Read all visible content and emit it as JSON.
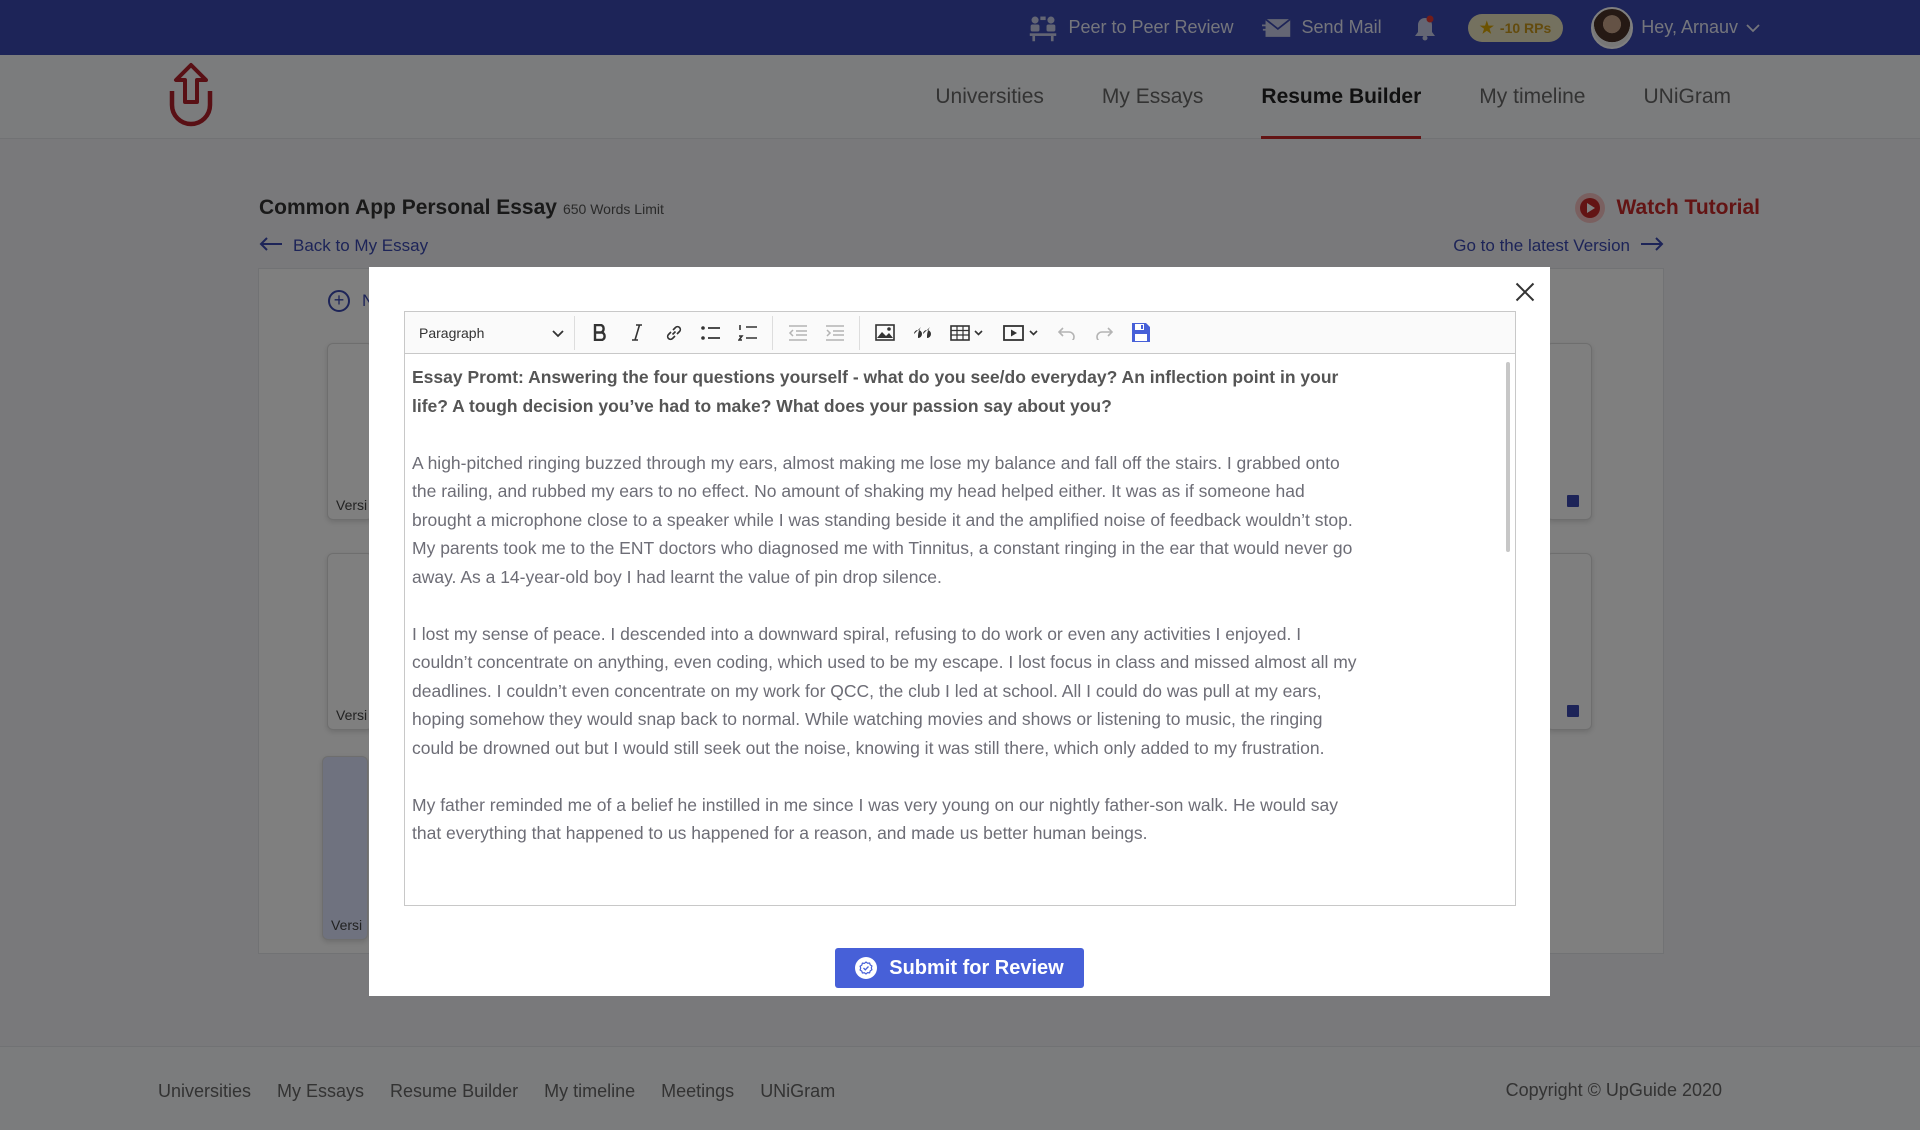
{
  "topbar": {
    "peer_review": "Peer to Peer Review",
    "send_mail": "Send Mail",
    "rp_badge": "-10 RPs",
    "greeting": "Hey, Arnauv"
  },
  "nav": {
    "items": [
      "Universities",
      "My Essays",
      "Resume Builder",
      "My timeline",
      "UNiGram"
    ],
    "active": "Resume Builder",
    "accent_color": "#c62828"
  },
  "page": {
    "title": "Common App Personal Essay",
    "word_limit": "650 Words Limit",
    "back_link": "Back to My Essay",
    "latest_link": "Go to the latest Version",
    "watch_tutorial": "Watch Tutorial",
    "add_version_label": "N",
    "version_label": "Versi"
  },
  "editor": {
    "block_format": "Paragraph",
    "toolbar_icons": [
      "bold-icon",
      "italic-icon",
      "link-icon",
      "bulleted-list-icon",
      "numbered-list-icon",
      "outdent-icon",
      "indent-icon",
      "image-icon",
      "blockquote-icon",
      "table-icon",
      "media-icon",
      "undo-icon",
      "redo-icon",
      "save-icon"
    ],
    "paragraphs": [
      "Essay Promt: Answering the four questions yourself - what do you see/do everyday? An inflection point in your life? A tough  decision you’ve had to make? What does your passion say about you?",
      "A  high-pitched ringing buzzed through my ears, almost making me lose my balance and fall off the stairs. I grabbed onto the railing, and rubbed my ears to no effect. No amount of shaking my head helped either. It was as if someone had brought a microphone close to a speaker while I was standing beside it and the amplified noise of feedback wouldn’t stop. My parents took me to the ENT doctors who diagnosed me with Tinnitus, a constant ringing in the ear that would never go away. As a 14-year-old boy I had learnt the value of pin drop silence.",
      "I lost my sense of peace. I descended  into a downward spiral, refusing to do work or even any activities I enjoyed. I couldn’t concentrate on anything, even coding, which used to be my escape. I lost focus in class and missed almost all my deadlines. I couldn’t even concentrate on my work for QCC, the club I led at school. All I could do was pull at my ears, hoping somehow they would snap back to normal. While watching movies and shows or listening to music, the ringing could be drowned out but I would still seek out the noise, knowing it was still there, which only added to my frustration.",
      "My father reminded me of a belief he instilled in me since I was very young on our nightly father-son walk. He would say that everything that happened to us happened for a reason, and made us better human beings."
    ],
    "submit_label": "Submit for Review",
    "primary_color": "#4760d8"
  },
  "footer": {
    "links": [
      "Universities",
      "My Essays",
      "Resume Builder",
      "My timeline",
      "Meetings",
      "UNiGram"
    ],
    "copyright": "Copyright © UpGuide 2020"
  }
}
